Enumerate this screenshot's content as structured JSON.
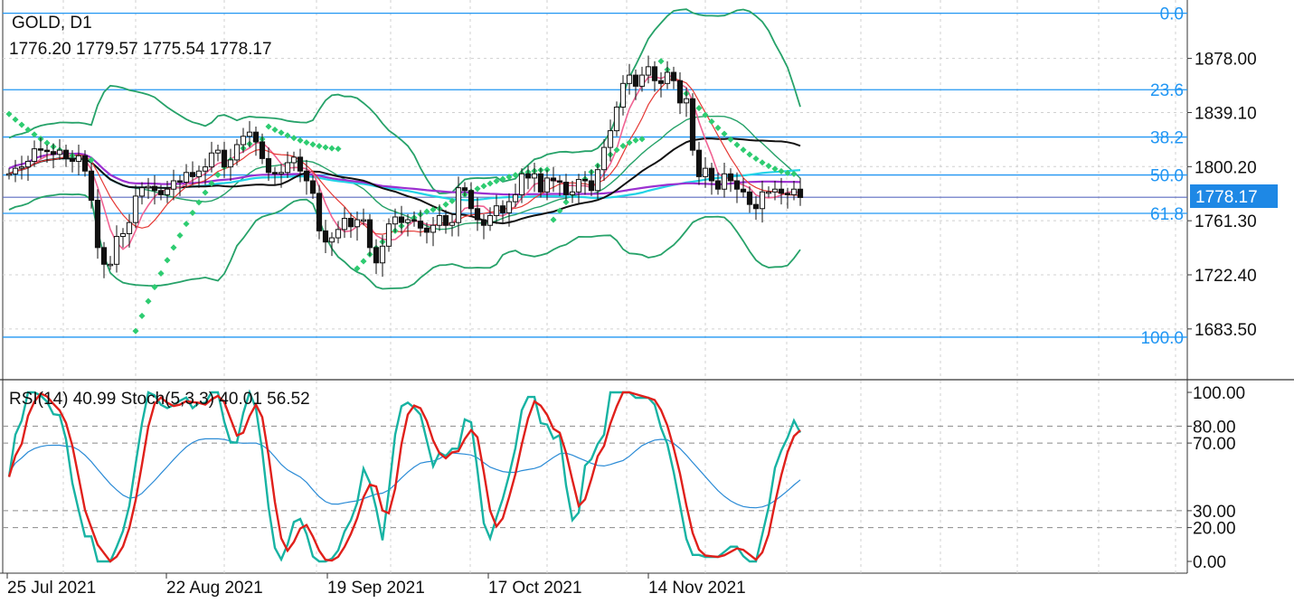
{
  "header": {
    "symbol": "GOLD, D1",
    "ohlc": "1776.20 1779.57 1775.54 1778.17"
  },
  "current_price": "1778.17",
  "colors": {
    "fib": "#2196f3",
    "bollinger": "#26a269",
    "sar": "#2ecc71",
    "ma_black": "#111111",
    "ma_purple": "#9b30d0",
    "ma_cyan": "#22d3e6",
    "ma_pink": "#f06292",
    "ma_red": "#e53935",
    "rsi": "#2b8bd6",
    "stoch_main": "#17b3a3",
    "stoch_signal": "#e0201b",
    "price_tag": "#1e88e5"
  },
  "fib_levels": [
    {
      "label": "0.0",
      "price": 1910.5
    },
    {
      "label": "23.6",
      "price": 1855.5
    },
    {
      "label": "38.2",
      "price": 1821.5
    },
    {
      "label": "50.0",
      "price": 1794.2
    },
    {
      "label": "61.8",
      "price": 1766.6
    },
    {
      "label": "100.0",
      "price": 1677.6
    }
  ],
  "price_axis": {
    "ticks": [
      "1878.00",
      "1839.10",
      "1800.20",
      "1761.30",
      "1722.40",
      "1683.50"
    ],
    "values": [
      1878.0,
      1839.1,
      1800.2,
      1761.3,
      1722.4,
      1683.5
    ],
    "ylim": [
      1647,
      1920
    ]
  },
  "indicator": {
    "label": "RSI(14) 40.99 Stoch(5,3,3) 40.01 56.52",
    "ticks": [
      "100.00",
      "80.00",
      "70.00",
      "30.00",
      "20.00",
      "0.00"
    ],
    "values": [
      100,
      80,
      70,
      30,
      20,
      0
    ],
    "dashed_levels": [
      80,
      70,
      30,
      20
    ]
  },
  "time_axis": {
    "labels": [
      "25 Jul 2021",
      "22 Aug 2021",
      "19 Sep 2021",
      "17 Oct 2021",
      "14 Nov 2021"
    ]
  },
  "chart_data": {
    "type": "candlestick",
    "title": "GOLD, D1",
    "ohlc_last": [
      1776.2,
      1779.57,
      1775.54,
      1778.17
    ],
    "x_labels": [
      "25 Jul 2021",
      "22 Aug 2021",
      "19 Sep 2021",
      "17 Oct 2021",
      "14 Nov 2021"
    ],
    "close_series": [
      1795,
      1799,
      1800,
      1804,
      1813,
      1812,
      1811,
      1809,
      1812,
      1806,
      1804,
      1808,
      1797,
      1776,
      1742,
      1730,
      1730,
      1750,
      1752,
      1760,
      1779,
      1785,
      1786,
      1783,
      1780,
      1784,
      1790,
      1789,
      1796,
      1793,
      1797,
      1800,
      1810,
      1812,
      1800,
      1805,
      1816,
      1822,
      1825,
      1818,
      1806,
      1796,
      1795,
      1796,
      1803,
      1807,
      1797,
      1790,
      1781,
      1754,
      1746,
      1749,
      1755,
      1763,
      1757,
      1762,
      1762,
      1742,
      1731,
      1743,
      1759,
      1764,
      1760,
      1762,
      1761,
      1756,
      1753,
      1758,
      1765,
      1758,
      1760,
      1785,
      1783,
      1770,
      1762,
      1758,
      1765,
      1772,
      1767,
      1775,
      1780,
      1795,
      1792,
      1795,
      1782,
      1792,
      1790,
      1789,
      1780,
      1782,
      1791,
      1790,
      1783,
      1798,
      1814,
      1826,
      1843,
      1860,
      1866,
      1858,
      1866,
      1872,
      1862,
      1860,
      1868,
      1862,
      1846,
      1849,
      1812,
      1793,
      1799,
      1790,
      1784,
      1795,
      1790,
      1784,
      1782,
      1773,
      1770,
      1782,
      1782,
      1784,
      1781,
      1780,
      1784,
      1778
    ],
    "ylim": [
      1647,
      1920
    ],
    "fibonacci": {
      "0.0": 1910.5,
      "23.6": 1855.5,
      "38.2": 1821.5,
      "50.0": 1794.2,
      "61.8": 1766.6,
      "100.0": 1677.6
    },
    "rsi_label": "RSI(14) 40.99",
    "stoch_label": "Stoch(5,3,3) 40.01 56.52",
    "indicator_ylim": [
      0,
      100
    ]
  }
}
